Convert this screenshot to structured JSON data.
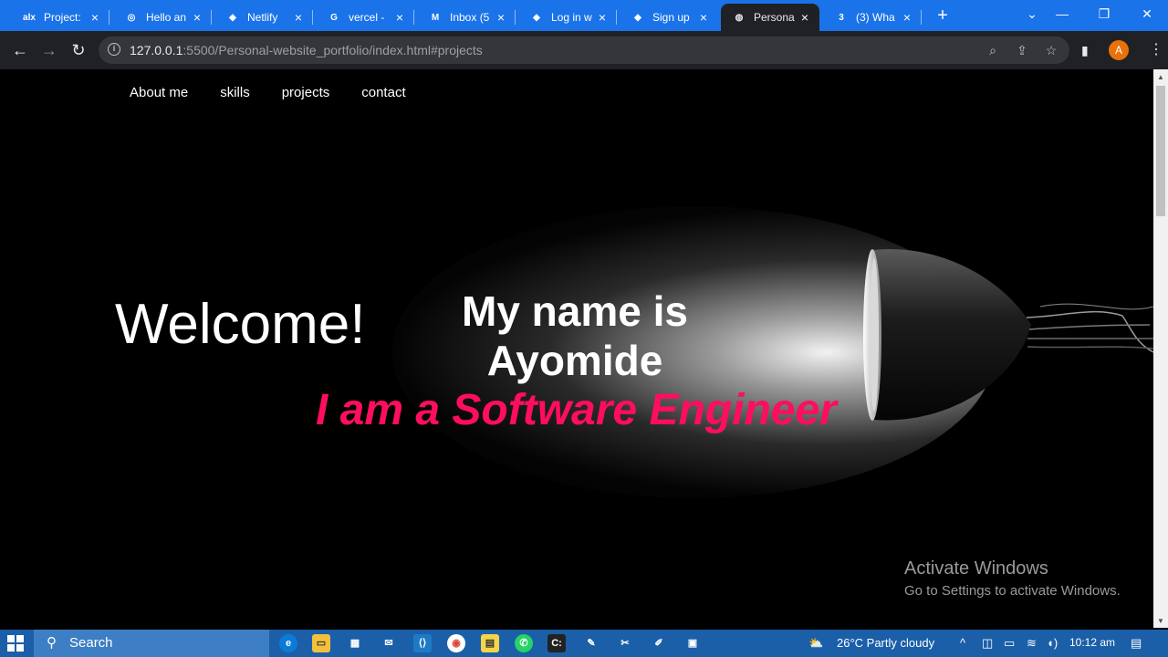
{
  "browser": {
    "tabs": [
      {
        "title": "Project:",
        "icon": "alx-icon",
        "fav": "alx",
        "favColor": "#1a73e8"
      },
      {
        "title": "Hello an",
        "icon": "openai-icon",
        "fav": "◎",
        "favColor": "#1a73e8"
      },
      {
        "title": "Netlify",
        "icon": "netlify-icon",
        "fav": "◆",
        "favColor": "#1a73e8"
      },
      {
        "title": "vercel -",
        "icon": "google-icon",
        "fav": "G",
        "favColor": "#1a73e8"
      },
      {
        "title": "Inbox (5",
        "icon": "gmail-icon",
        "fav": "M",
        "favColor": "#1a73e8"
      },
      {
        "title": "Log in w",
        "icon": "netlify-icon",
        "fav": "◆",
        "favColor": "#1a73e8"
      },
      {
        "title": "Sign up",
        "icon": "netlify-icon",
        "fav": "◆",
        "favColor": "#1a73e8"
      },
      {
        "title": "Persona",
        "icon": "globe-icon",
        "fav": "◍",
        "favColor": "#202124",
        "active": true
      },
      {
        "title": "(3) Wha",
        "icon": "whatsapp-icon",
        "fav": "3",
        "favColor": "#1a73e8"
      }
    ],
    "url_host": "127.0.0.1",
    "url_rest": ":5500/Personal-website_portfolio/index.html#projects",
    "profile_initial": "A"
  },
  "site": {
    "nav": [
      "About me",
      "skills",
      "projects",
      "contact"
    ],
    "welcome": "Welcome!",
    "name_line1": "My name is",
    "name_line2": "Ayomide",
    "role": "I am a Software Engineer"
  },
  "watermark": {
    "title": "Activate Windows",
    "subtitle": "Go to Settings to activate Windows."
  },
  "taskbar": {
    "search_label": "Search",
    "weather": "26°C  Partly cloudy",
    "time": "10:12 am"
  },
  "colors": {
    "accent": "#ff0d5f",
    "tabbar": "#1a73e8",
    "taskbar": "#1b5fa8"
  }
}
